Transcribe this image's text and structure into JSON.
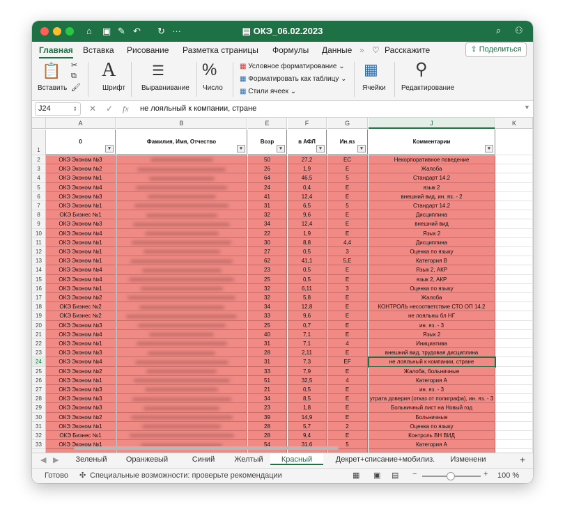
{
  "window": {
    "title": "ОКЭ_06.02.2023"
  },
  "ribbon_tabs": [
    "Главная",
    "Вставка",
    "Рисование",
    "Разметка страницы",
    "Формулы",
    "Данные",
    "Расскажите"
  ],
  "share_label": "Поделиться",
  "ribbon": {
    "paste": "Вставить",
    "font": "Шрифт",
    "align": "Выравнивание",
    "number": "Число",
    "cond_format": "Условное форматирование",
    "format_table": "Форматировать как таблицу",
    "cell_styles": "Стили ячеек",
    "cells": "Ячейки",
    "edit": "Редактирование"
  },
  "formula_bar": {
    "name_box": "J24",
    "fx": "fx",
    "value": "не лояльный к компании, стране"
  },
  "columns": [
    {
      "letter": "A",
      "header": "0"
    },
    {
      "letter": "B",
      "header": "Фамилия, Имя, Отчество"
    },
    {
      "letter": "E",
      "header": "Возр"
    },
    {
      "letter": "F",
      "header": "в АФЛ"
    },
    {
      "letter": "G",
      "header": "Ин.яз"
    },
    {
      "letter": "J",
      "header": "Комментарии"
    },
    {
      "letter": "K",
      "header": ""
    }
  ],
  "rows": [
    {
      "n": "2",
      "a": "ОКЭ Эконом №3",
      "e": "50",
      "f": "27,2",
      "g": "ЕС",
      "j": "Некорпоративное поведение"
    },
    {
      "n": "3",
      "a": "ОКЭ Эконом №2",
      "e": "26",
      "f": "1,9",
      "g": "Е",
      "j": "Жалоба"
    },
    {
      "n": "4",
      "a": "ОКЭ Эконом №1",
      "e": "64",
      "f": "46,5",
      "g": "5",
      "j": "Стандарт 14.2"
    },
    {
      "n": "5",
      "a": "ОКЭ Эконом №4",
      "e": "24",
      "f": "0,4",
      "g": "Е",
      "j": "язык 2"
    },
    {
      "n": "6",
      "a": "ОКЭ Эконом №3",
      "e": "41",
      "f": "12,4",
      "g": "Е",
      "j": "внешний вид, ин. яз. - 2"
    },
    {
      "n": "7",
      "a": "ОКЭ Эконом №1",
      "e": "31",
      "f": "6,5",
      "g": "5",
      "j": "Стандарт 14.2"
    },
    {
      "n": "8",
      "a": "ОКЭ Бизнес №1",
      "e": "32",
      "f": "9,6",
      "g": "Е",
      "j": "Дисциплина"
    },
    {
      "n": "9",
      "a": "ОКЭ Эконом №3",
      "e": "34",
      "f": "12,4",
      "g": "Е",
      "j": "внешний вид"
    },
    {
      "n": "10",
      "a": "ОКЭ Эконом №4",
      "e": "22",
      "f": "1,9",
      "g": "Е",
      "j": "Язык 2"
    },
    {
      "n": "11",
      "a": "ОКЭ Эконом №1",
      "e": "30",
      "f": "8,8",
      "g": "4,4",
      "j": "Дисциплина"
    },
    {
      "n": "12",
      "a": "ОКЭ Эконом №1",
      "e": "27",
      "f": "0,5",
      "g": "3",
      "j": "Оценка по языку"
    },
    {
      "n": "13",
      "a": "ОКЭ Эконом №1",
      "e": "62",
      "f": "41,1",
      "g": "5,Е",
      "j": "Категория В"
    },
    {
      "n": "14",
      "a": "ОКЭ Эконом №4",
      "e": "23",
      "f": "0,5",
      "g": "Е",
      "j": "Язык 2, АКР"
    },
    {
      "n": "15",
      "a": "ОКЭ Эконом №4",
      "e": "25",
      "f": "0,5",
      "g": "Е",
      "j": "язык 2, АКР"
    },
    {
      "n": "16",
      "a": "ОКЭ Эконом №1",
      "e": "32",
      "f": "6,11",
      "g": "3",
      "j": "Оценка по языку"
    },
    {
      "n": "17",
      "a": "ОКЭ Эконом №2",
      "e": "32",
      "f": "5,8",
      "g": "Е",
      "j": "Жалоба"
    },
    {
      "n": "18",
      "a": "ОКЭ Бизнес №2",
      "e": "34",
      "f": "12,8",
      "g": "Е",
      "j": "КОНТРОЛЬ несоответствие СТО ОП 14.2"
    },
    {
      "n": "19",
      "a": "ОКЭ Бизнес №2",
      "e": "33",
      "f": "9,6",
      "g": "Е",
      "j": "не лояльны бл НГ"
    },
    {
      "n": "20",
      "a": "ОКЭ Эконом №3",
      "e": "25",
      "f": "0,7",
      "g": "Е",
      "j": "ин. яз. - 3"
    },
    {
      "n": "21",
      "a": "ОКЭ Эконом №4",
      "e": "40",
      "f": "7,1",
      "g": "Е",
      "j": "Язык 2"
    },
    {
      "n": "22",
      "a": "ОКЭ Эконом №1",
      "e": "31",
      "f": "7,1",
      "g": "4",
      "j": "Инициатива"
    },
    {
      "n": "23",
      "a": "ОКЭ Эконом №3",
      "e": "28",
      "f": "2,11",
      "g": "Е",
      "j": "внешний вид, трудовая дисциплина"
    },
    {
      "n": "24",
      "a": "ОКЭ Эконом №4",
      "e": "31",
      "f": "7,3",
      "g": "ЕF",
      "j": "не лояльный к компании, стране"
    },
    {
      "n": "25",
      "a": "ОКЭ Эконом №2",
      "e": "33",
      "f": "7,9",
      "g": "Е",
      "j": "Жалоба, больничные"
    },
    {
      "n": "26",
      "a": "ОКЭ Эконом №1",
      "e": "51",
      "f": "32,5",
      "g": "4",
      "j": "Категория А"
    },
    {
      "n": "27",
      "a": "ОКЭ Эконом №3",
      "e": "21",
      "f": "0,5",
      "g": "Е",
      "j": "ин. яз. - 3"
    },
    {
      "n": "28",
      "a": "ОКЭ Эконом №3",
      "e": "34",
      "f": "8,5",
      "g": "Е",
      "j": "утрата доверия (отказ от полиграфа), ин. яз. - 3"
    },
    {
      "n": "29",
      "a": "ОКЭ Эконом №3",
      "e": "23",
      "f": "1,8",
      "g": "Е",
      "j": "Больничный лист на Новый год"
    },
    {
      "n": "30",
      "a": "ОКЭ Эконом №2",
      "e": "39",
      "f": "14,9",
      "g": "Е",
      "j": "Больничные"
    },
    {
      "n": "31",
      "a": "ОКЭ Эконом №1",
      "e": "28",
      "f": "5,7",
      "g": "2",
      "j": "Оценка по языку"
    },
    {
      "n": "32",
      "a": "ОКЭ Бизнес №1",
      "e": "28",
      "f": "9,4",
      "g": "Е",
      "j": "Контроль ВН ВИД"
    },
    {
      "n": "33",
      "a": "ОКЭ Эконом №1",
      "e": "54",
      "f": "31,6",
      "g": "5",
      "j": "Категория А"
    }
  ],
  "sheets": [
    "Зеленый",
    "Оранжевый",
    "Синий",
    "Желтый",
    "Красный",
    "Декрет+списание+мобилиз.",
    "Изменени"
  ],
  "active_sheet_index": 4,
  "status": {
    "ready": "Готово",
    "accessibility": "Специальные возможности: проверьте рекомендации",
    "zoom": "100 %"
  },
  "colors": {
    "green": "#1e7145",
    "red_fill": "#f18a85"
  }
}
